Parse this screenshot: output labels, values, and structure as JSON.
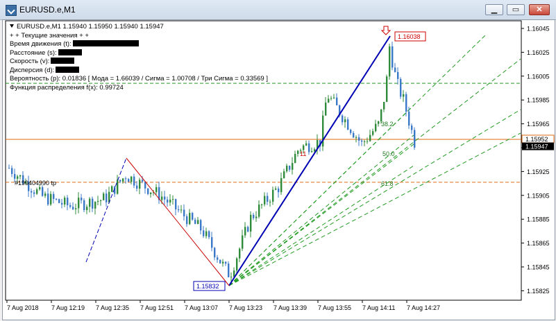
{
  "window": {
    "title": "EURUSD.e,M1",
    "controls": [
      "minimize",
      "restore",
      "close"
    ]
  },
  "info_panel": {
    "header": "EURUSD.e,M1  1.15940 1.15950 1.15940 1.15947",
    "lines": [
      {
        "label": "+ + Текущие значения + +",
        "redacted": false
      },
      {
        "label": "Время движения (t):",
        "redacted": true
      },
      {
        "label": "Расстояние (s):",
        "redacted": true
      },
      {
        "label": "Скорость (v):",
        "redacted": true
      },
      {
        "label": "Дисперсия (d):",
        "redacted": true
      },
      {
        "label": "Вероятность (р): 0.01836 [ Мода = 1.66039 / Сигма = 1.00708 / Три Сигма = 0.33569 ]",
        "redacted": false
      },
      {
        "label": "Функция распределения f(x): 0.99724",
        "redacted": false
      }
    ]
  },
  "annotations": {
    "tp_label": "#199404990 tp",
    "fib_382": "38.2",
    "fib_500": "50.0",
    "fib_618": "61.8",
    "marker_11": "11",
    "high_label": "1.16038",
    "low_label": "1.15832"
  },
  "price_axis": {
    "ticks": [
      "1.16045",
      "1.16025",
      "1.16005",
      "1.15985",
      "1.15965",
      "1.15945",
      "1.15925",
      "1.15905",
      "1.15885",
      "1.15865",
      "1.15845",
      "1.15825"
    ],
    "tag_orange": "1.15952",
    "tag_current": "1.15947"
  },
  "time_axis": {
    "ticks": [
      "7 Aug 2018",
      "7 Aug 12:19",
      "7 Aug 12:35",
      "7 Aug 12:51",
      "7 Aug 13:07",
      "7 Aug 13:23",
      "7 Aug 13:39",
      "7 Aug 13:55",
      "7 Aug 14:11",
      "7 Aug 14:27"
    ]
  },
  "colors": {
    "bull": "#2e8b3a",
    "bear": "#3a78c8",
    "trend": "#0000b4",
    "fib": "#1f9a1f",
    "orange": "#e06a10",
    "red": "#cc0000"
  }
}
